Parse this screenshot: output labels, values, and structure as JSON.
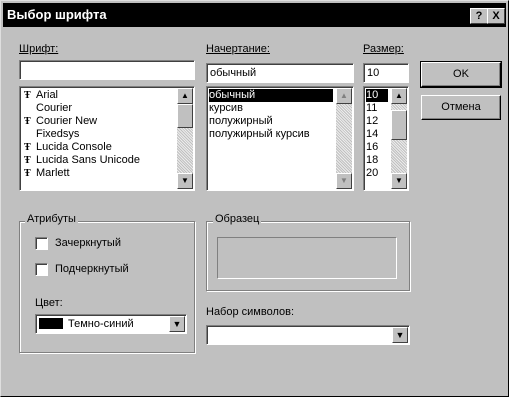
{
  "window": {
    "title": "Выбор шрифта",
    "help_button": "?",
    "close_button": "X"
  },
  "font": {
    "label": "Шрифт:",
    "value": "",
    "items": [
      {
        "name": "Arial",
        "truetype": true
      },
      {
        "name": "Courier",
        "truetype": false
      },
      {
        "name": "Courier New",
        "truetype": true
      },
      {
        "name": "Fixedsys",
        "truetype": false
      },
      {
        "name": "Lucida Console",
        "truetype": true
      },
      {
        "name": "Lucida Sans Unicode",
        "truetype": true
      },
      {
        "name": "Marlett",
        "truetype": true
      }
    ],
    "truetype_glyph": "Ŧ"
  },
  "style": {
    "label": "Начертание:",
    "value": "обычный",
    "items": [
      "обычный",
      "курсив",
      "полужирный",
      "полужирный курсив"
    ],
    "selected": 0
  },
  "size": {
    "label": "Размер:",
    "value": "10",
    "items": [
      "10",
      "11",
      "12",
      "14",
      "16",
      "18",
      "20"
    ],
    "selected": 0
  },
  "buttons": {
    "ok": "OK",
    "cancel": "Отмена"
  },
  "attributes": {
    "title": "Атрибуты",
    "strikeout": "Зачеркнутый",
    "underline": "Подчеркнутый",
    "strikeout_checked": false,
    "underline_checked": false,
    "color_label": "Цвет:",
    "color_value": "Темно-синий",
    "color_swatch": "#000000"
  },
  "sample": {
    "title": "Образец",
    "text": ""
  },
  "charset": {
    "label": "Набор символов:",
    "value": ""
  },
  "colors": {
    "face": "#c0c0c0",
    "titlebar": "#000000",
    "selection": "#000000"
  }
}
